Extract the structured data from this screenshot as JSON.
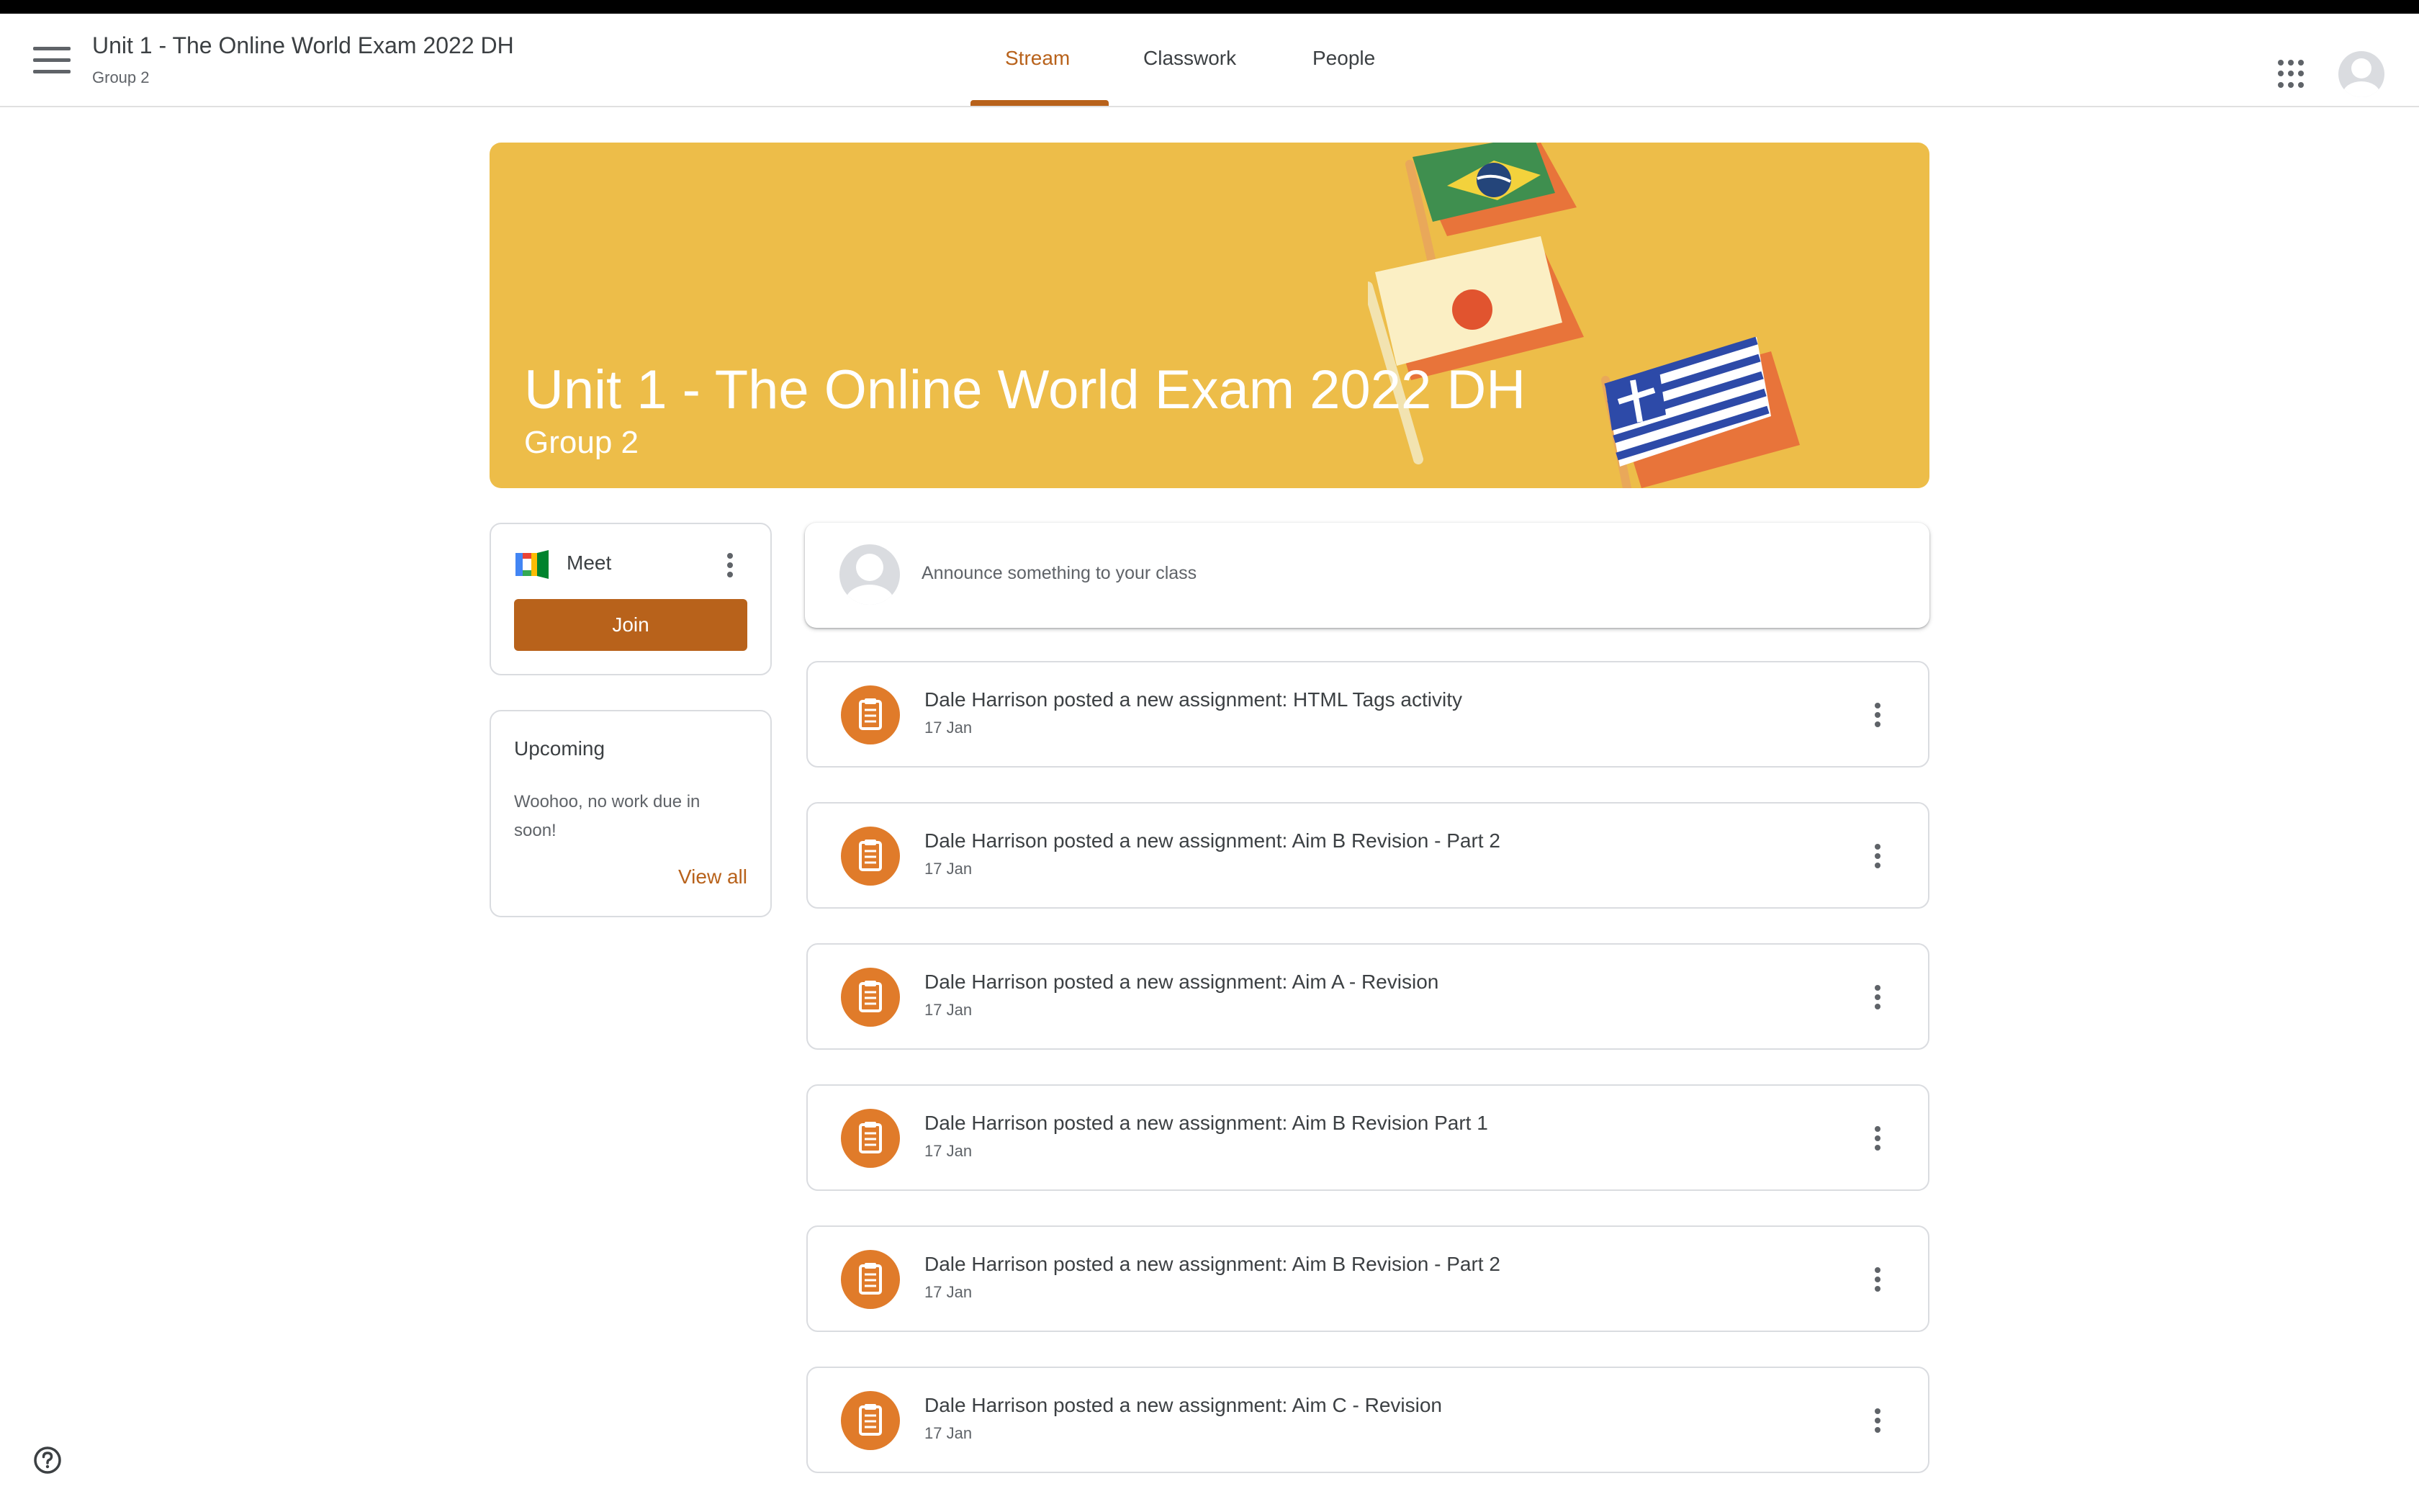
{
  "header": {
    "class_title": "Unit 1 - The Online World Exam 2022 DH",
    "class_subtitle": "Group 2",
    "tabs": [
      {
        "label": "Stream",
        "active": true
      },
      {
        "label": "Classwork",
        "active": false
      },
      {
        "label": "People",
        "active": false
      }
    ]
  },
  "banner": {
    "title": "Unit 1 - The Online World Exam 2022 DH",
    "subtitle": "Group 2",
    "color": "#edbd49"
  },
  "meet": {
    "label": "Meet",
    "join_label": "Join"
  },
  "upcoming": {
    "title": "Upcoming",
    "message": "Woohoo, no work due in soon!",
    "view_all": "View all"
  },
  "announce": {
    "placeholder": "Announce something to your class"
  },
  "posts": [
    {
      "title": "Dale Harrison posted a new assignment: HTML Tags activity",
      "date": "17 Jan"
    },
    {
      "title": "Dale Harrison posted a new assignment: Aim B Revision - Part 2",
      "date": "17 Jan"
    },
    {
      "title": "Dale Harrison posted a new assignment: Aim A - Revision",
      "date": "17 Jan"
    },
    {
      "title": "Dale Harrison posted a new assignment: Aim B Revision Part 1",
      "date": "17 Jan"
    },
    {
      "title": "Dale Harrison posted a new assignment: Aim B Revision - Part 2",
      "date": "17 Jan"
    },
    {
      "title": "Dale Harrison posted a new assignment: Aim C - Revision",
      "date": "17 Jan"
    }
  ],
  "theme": {
    "accent": "#b8621b",
    "assignment_icon_bg": "#e07b2a"
  }
}
